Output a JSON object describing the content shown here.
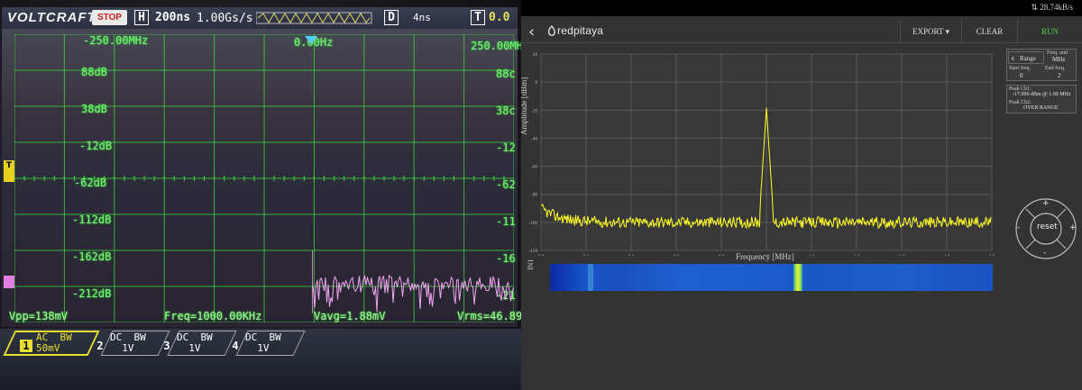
{
  "scope": {
    "brand": "VOLTCRAFT.",
    "run_state": "STOP",
    "timebase_prefix": "H",
    "timebase": "200ns",
    "sample_rate": "1.00Gs/s",
    "delay_prefix": "D",
    "delay": "4ns",
    "trigger_prefix": "T",
    "trigger": "0.0",
    "freq_left": "-250.00MHz",
    "freq_center": "0.00Hz",
    "freq_right": "250.00MH",
    "db_labels": [
      "88dB",
      "38dB",
      "-12dB",
      "-62dB",
      "-112dB",
      "-162dB",
      "-212dB"
    ],
    "right_db_labels": [
      "88c",
      "38c",
      "-12",
      "-62",
      "-11",
      "-16",
      "-21"
    ],
    "trigger_marker": "T",
    "measurements": {
      "vpp": "Vpp=138mV",
      "freq": "Freq=1000.00KHz",
      "vavg": "Vavg=1.88mV",
      "vrms": "Vrms=46.89"
    },
    "channels": [
      {
        "num": "1",
        "coupling": "AC",
        "bw": "BW",
        "scale": "50mV"
      },
      {
        "num": "2",
        "coupling": "DC",
        "bw": "BW",
        "scale": "1V"
      },
      {
        "num": "3",
        "coupling": "DC",
        "bw": "BW",
        "scale": "1V"
      },
      {
        "num": "4",
        "coupling": "DC",
        "bw": "BW",
        "scale": "1V"
      }
    ]
  },
  "redpitaya": {
    "status_rate": "28.74kB/s",
    "logo": "redpitaya",
    "back_icon": "chevron-left-icon",
    "nav": {
      "export": "EXPORT",
      "clear": "CLEAR",
      "run": "RUN"
    },
    "y_axis_label": "Amplitude [dBm]",
    "x_axis_label": "Frequency [MHz]",
    "y_ticks": [
      "20",
      "0",
      "-20",
      "-40",
      "-60",
      "-80",
      "-100",
      "-120"
    ],
    "x_ticks": [
      "0.0",
      "0.2",
      "0.4",
      "0.6",
      "0.8",
      "1.0",
      "1.2",
      "1.4",
      "1.6",
      "1.8",
      "2.0"
    ],
    "waterfall_label": "IN1",
    "range": {
      "label": "Range",
      "unit_label": "Freq. unit",
      "unit": "MHz",
      "start_label": "Start freq.",
      "start": "0",
      "end_label": "End freq.",
      "end": "2"
    },
    "peak1": {
      "label": "Peak Ch1:",
      "value": "-17.996 dBm @ 1.00 MHz"
    },
    "peak2": {
      "label": "Peak Ch2:",
      "value": "OVER RANGE"
    },
    "joystick": {
      "center": "reset",
      "plus_top": "+",
      "minus_bottom": "-",
      "minus_left": "-",
      "plus_right": "+"
    },
    "colors": {
      "trace": "#ffff22",
      "background": "#333333",
      "grid": "#5a5a5a",
      "run": "#4fcf4f"
    }
  }
}
